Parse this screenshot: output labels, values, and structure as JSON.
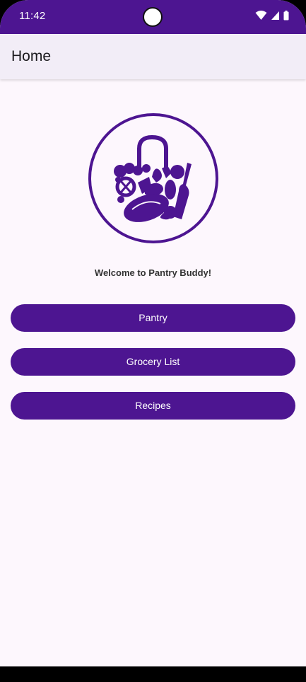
{
  "status_bar": {
    "time": "11:42",
    "icons": [
      "wifi-icon",
      "signal-icon",
      "battery-icon"
    ]
  },
  "app_bar": {
    "title": "Home"
  },
  "logo": {
    "icon": "grocery-bag-logo"
  },
  "welcome_text": "Welcome to Pantry Buddy!",
  "buttons": {
    "pantry": "Pantry",
    "grocery_list": "Grocery List",
    "recipes": "Recipes"
  },
  "colors": {
    "primary": "#4D1591",
    "background": "#FDF7FD",
    "app_bar": "#F2EDF7"
  }
}
